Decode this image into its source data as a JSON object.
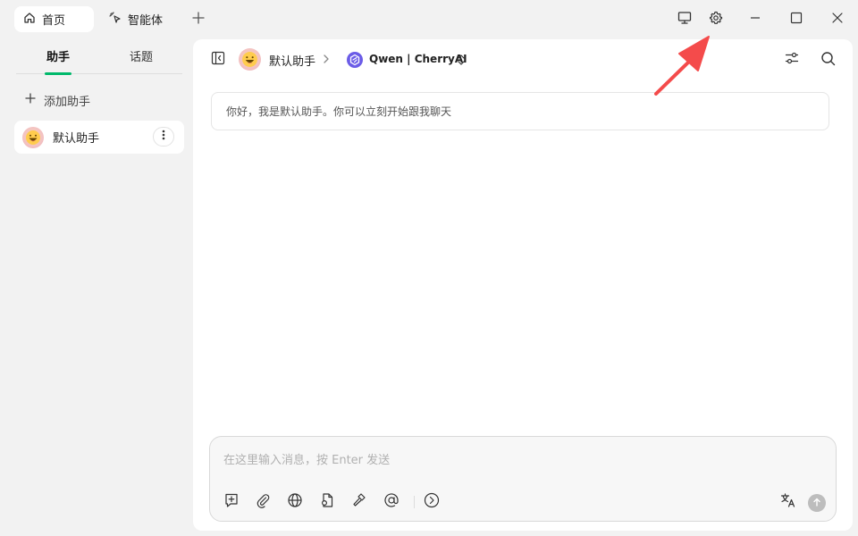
{
  "titlebar": {
    "tabs": [
      {
        "label": "首页",
        "icon": "home-icon",
        "active": true
      },
      {
        "label": "智能体",
        "icon": "sparkle-cursor-icon",
        "active": false
      }
    ],
    "new_tab_icon": "plus-icon",
    "right_icons": [
      "monitor-icon",
      "gear-icon",
      "minimize-icon",
      "maximize-icon",
      "close-icon"
    ]
  },
  "sidebar": {
    "tabs": [
      {
        "label": "助手",
        "active": true
      },
      {
        "label": "话题",
        "active": false
      }
    ],
    "add_label": "添加助手",
    "assistants": [
      {
        "name": "默认助手",
        "avatar": "grinning-face-emoji"
      }
    ]
  },
  "header": {
    "assistant_name": "默认助手",
    "model_label": "Qwen | CherryAI"
  },
  "chat": {
    "greeting": "你好，我是默认助手。你可以立刻开始跟我聊天"
  },
  "input": {
    "placeholder": "在这里输入消息，按 Enter 发送",
    "value": "",
    "tools": [
      "new-topic-icon",
      "attachment-icon",
      "web-search-icon",
      "knowledge-base-icon",
      "mcp-tools-icon",
      "mention-model-icon",
      "expand-more-icon"
    ],
    "right_tools": [
      "translate-icon",
      "send-icon"
    ]
  },
  "colors": {
    "accent": "#00b96b",
    "annotation_arrow": "#f44b4b",
    "model_logo": "#6b5ce7"
  }
}
